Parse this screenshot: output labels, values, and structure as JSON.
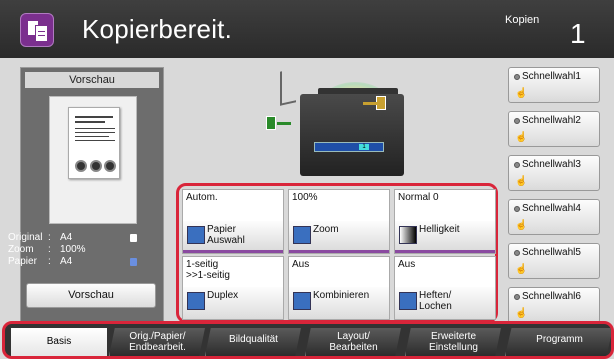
{
  "header": {
    "status_title": "Kopierbereit.",
    "copies_label": "Kopien",
    "copies_count": "1"
  },
  "preview_panel": {
    "title": "Vorschau",
    "info": [
      {
        "key": "Original",
        "value": "A4"
      },
      {
        "key": "Zoom",
        "value": "100%"
      },
      {
        "key": "Papier",
        "value": "A4"
      }
    ],
    "button_label": "Vorschau"
  },
  "speed_dials": [
    "Schnellwahl1",
    "Schnellwahl2",
    "Schnellwahl3",
    "Schnellwahl4",
    "Schnellwahl5",
    "Schnellwahl6"
  ],
  "machine_panel_number": "1",
  "functions": [
    {
      "value": "Autom.",
      "label": "Papier\nAuswahl",
      "icon": "paper-select-icon"
    },
    {
      "value": "100%",
      "label": "Zoom",
      "icon": "zoom-icon"
    },
    {
      "value": "Normal 0",
      "label": "Helligkeit",
      "icon": "density-icon"
    },
    {
      "value": "1-seitig\n>>1-seitig",
      "label": "Duplex",
      "icon": "duplex-icon"
    },
    {
      "value": "Aus",
      "label": "Kombinieren",
      "icon": "combine-icon"
    },
    {
      "value": "Aus",
      "label": "Heften/\nLochen",
      "icon": "staple-punch-icon"
    }
  ],
  "tabs": [
    {
      "label": "Basis",
      "active": true
    },
    {
      "label": "Orig./Papier/\nEndbearbeit.",
      "active": false
    },
    {
      "label": "Bildqualität",
      "active": false
    },
    {
      "label": "Layout/\nBearbeiten",
      "active": false
    },
    {
      "label": "Erweiterte\nEinstellung",
      "active": false
    },
    {
      "label": "Programm",
      "active": false
    }
  ],
  "colors": {
    "accent_outline": "#d9253a",
    "header_bg": "#333333",
    "app_icon": "#7b2f8e",
    "function_underline": "#8a4aa0"
  }
}
